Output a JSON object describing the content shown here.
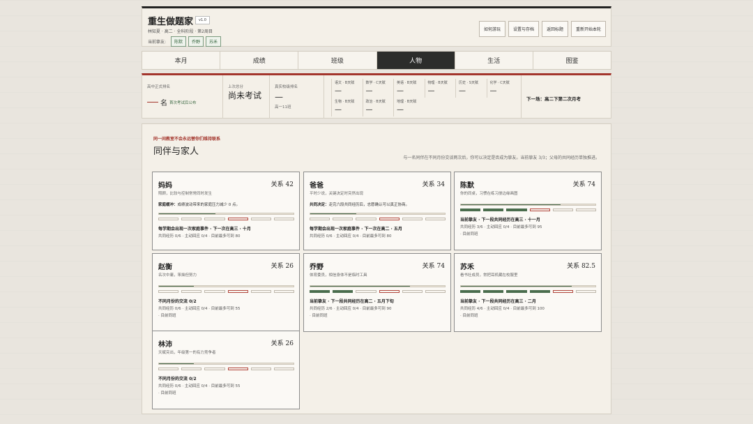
{
  "header": {
    "title": "重生做题家",
    "version": "v1.0",
    "subtitle": "林知夏 · 高二 · 全科阶段 · 第2周目",
    "companions_label": "当前挚友:",
    "companion_tags": [
      "陈默",
      "乔野",
      "苏禾"
    ],
    "buttons": [
      "如何游玩",
      "设置与存档",
      "返回标题",
      "重新开始本轮"
    ]
  },
  "tabs": [
    {
      "label": "本月",
      "active": false
    },
    {
      "label": "成绩",
      "active": false
    },
    {
      "label": "班级",
      "active": false
    },
    {
      "label": "人物",
      "active": true
    },
    {
      "label": "生活",
      "active": false
    },
    {
      "label": "图鉴",
      "active": false
    }
  ],
  "stats": {
    "rank_label": "高中正式排名",
    "rank_unit": "名",
    "rank_note": "首次考试后公布",
    "last_label": "上次总分",
    "last_value": "尚未考试",
    "school_label": "真实校级排名",
    "school_value": "—",
    "school_sub": "高一11班",
    "subjects": [
      {
        "name": "语文 · B天赋",
        "value": "—"
      },
      {
        "name": "数学 · C天赋",
        "value": "—"
      },
      {
        "name": "英语 · B天赋",
        "value": "—"
      },
      {
        "name": "物理 · B天赋",
        "value": "—"
      },
      {
        "name": "历史 · S天赋",
        "value": "—"
      },
      {
        "name": "化学 · C天赋",
        "value": "—"
      },
      {
        "name": "生物 · B天赋",
        "value": "—"
      },
      {
        "name": "政治 · B天赋",
        "value": "—"
      },
      {
        "name": "地理 · B天赋",
        "value": "—"
      }
    ],
    "next_exam": "下一场：高二下第二次月考"
  },
  "section": {
    "kicker": "同一间教室不会永远替你们维持联系",
    "title": "同伴与家人",
    "note": "与一名同伴在不同月份交谈两次后，你可以决定是否成为挚友。当前挚友 3/3；父母的共同经历单独推进。"
  },
  "people": [
    {
      "name": "妈妈",
      "relation": "关系 42",
      "desc": "照顾，比较与控制常常同时发生",
      "note_label": "家庭缓冲：",
      "note_text": "成绩波动带来的家庭压力减少 0 点。",
      "bar": 0.42,
      "segs_filled": 0,
      "seg_current": 3,
      "event": "每学期会出现一次家庭事件 · 下一次在高三 · 十月",
      "stat": "共同经历 0/6 · 主动回应 0/4 · 目前最多可到 80",
      "trans": ""
    },
    {
      "name": "爸爸",
      "relation": "关系 34",
      "desc": "平时少说，关键决定时突然出现",
      "note_label": "共同决定：",
      "note_text": "走完六段共同经历后，志愿确认可以真正协商。",
      "bar": 0.34,
      "segs_filled": 0,
      "seg_current": 3,
      "event": "每学期会出现一次家庭事件 · 下一次在高二 · 五月",
      "stat": "共同经历 0/6 · 主动回应 0/4 · 目前最多可到 80",
      "trans": ""
    },
    {
      "name": "陈默",
      "relation": "关系 74",
      "desc": "你的同桌，习惯在练习册边缘画图",
      "note_label": "",
      "note_text": "",
      "bar": 0.74,
      "segs_filled": 3,
      "seg_current": 3,
      "event": "当前挚友 · 下一段共同经历在高三 · 十一月",
      "stat": "共同经历 3/6 · 主动回应 0/4 · 目前最多可到 95",
      "trans": "· 目前同班"
    },
    {
      "name": "赵衡",
      "relation": "关系 26",
      "desc": "名次中庸，笨拙但努力",
      "note_label": "",
      "note_text": "",
      "bar": 0.26,
      "segs_filled": 0,
      "seg_current": 3,
      "event": "不同月份的交流 0/2",
      "stat": "共同经历 0/6 · 主动回应 0/4 · 目前最多可到 55",
      "trans": "· 目前同班"
    },
    {
      "name": "乔野",
      "relation": "关系 74",
      "desc": "体育委员，相信身体不是临时工具",
      "note_label": "",
      "note_text": "",
      "bar": 0.74,
      "segs_filled": 2,
      "seg_current": 3,
      "event": "当前挚友 · 下一段共同经历在高二 · 五月下旬",
      "stat": "共同经历 2/6 · 主动回应 0/4 · 目前最多可到 90",
      "trans": "· 目前同班"
    },
    {
      "name": "苏禾",
      "relation": "关系 82.5",
      "desc": "看书社成员，常把耳机藏在校服里",
      "note_label": "",
      "note_text": "",
      "bar": 0.825,
      "segs_filled": 4,
      "seg_current": 4,
      "event": "当前挚友 · 下一段共同经历在高三 · 二月",
      "stat": "共同经历 4/6 · 主动回应 0/4 · 目前最多可到 100",
      "trans": "· 目前同班"
    },
    {
      "name": "林沛",
      "relation": "关系 26",
      "desc": "天赋突出，年级第一的有力竞争者",
      "note_label": "",
      "note_text": "",
      "bar": 0.26,
      "segs_filled": 0,
      "seg_current": 3,
      "event": "不同月份的交流 0/2",
      "stat": "共同经历 0/6 · 主动回应 0/4 · 目前最多可到 55",
      "trans": "· 目前同班"
    }
  ]
}
